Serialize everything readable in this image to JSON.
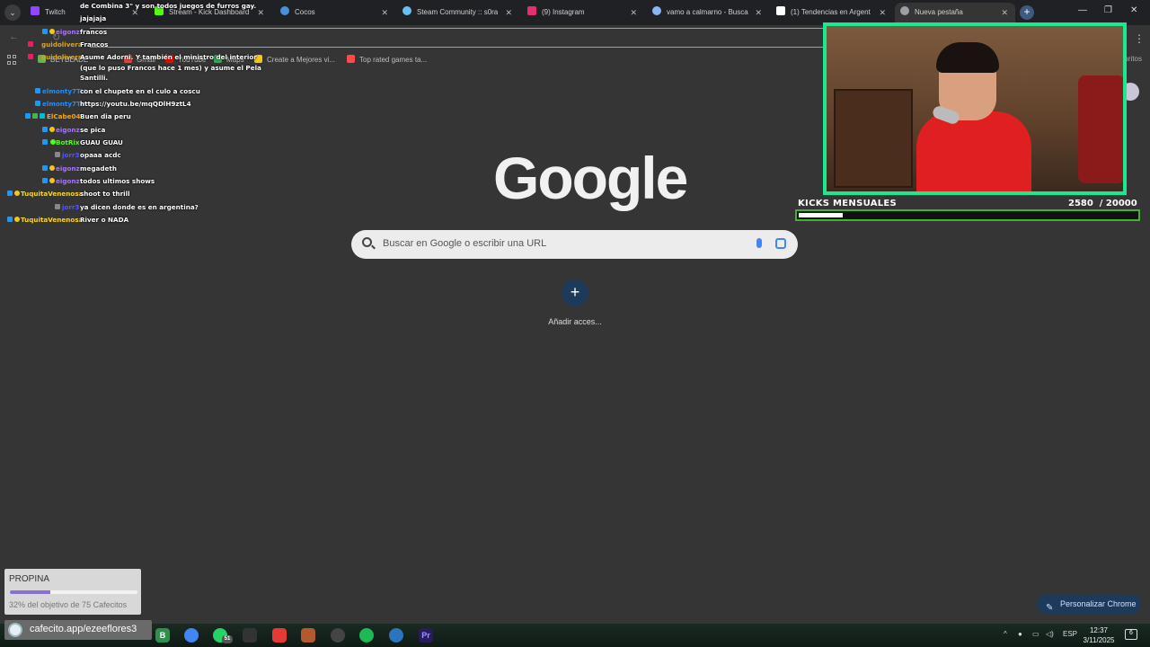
{
  "tabs": [
    {
      "title": "Twitch",
      "color": "#9146ff"
    },
    {
      "title": "Stream - Kick Dashboard",
      "color": "#53fc18"
    },
    {
      "title": "Cocos",
      "color": "#4a90d9"
    },
    {
      "title": "Steam Community :: s0ra",
      "color": "#66c0f4"
    },
    {
      "title": "(9) Instagram",
      "color": "#e1306c"
    },
    {
      "title": "vamo a calmarno - Busca",
      "color": "#8ab4f8"
    },
    {
      "title": "(1) Tendencias en Argent",
      "color": "#ffffff"
    },
    {
      "title": "Nueva pestaña",
      "color": "#9aa0a6"
    }
  ],
  "bookmarks": [
    {
      "label": "BEYBLADE",
      "color": "#6ab04c"
    },
    {
      "label": "Gmail",
      "color": "#ea4335"
    },
    {
      "label": "YouTube",
      "color": "#ff0000"
    },
    {
      "label": "Maps",
      "color": "#34a853"
    },
    {
      "label": "Create a Mejores vi...",
      "color": "#f5c518"
    },
    {
      "label": "Top rated games ta...",
      "color": "#ff4a4a"
    }
  ],
  "bookmarks_right": "Todos los favoritos",
  "google_logo": "Google",
  "search": {
    "placeholder": "Buscar en Google o escribir una URL"
  },
  "shortcut": {
    "label": "Añadir acces..."
  },
  "customize": "Personalizar Chrome",
  "chat": [
    {
      "user": "",
      "text": "de Combina 3\" y son todos juegos de furros gay.",
      "color": "#ffffff"
    },
    {
      "user": "",
      "text": "jajajaja",
      "color": "#ffffff"
    },
    {
      "user": "eigonz",
      "text": "francos",
      "color": "#a970ff"
    },
    {
      "user": "guidolivera",
      "text": "Francos",
      "color": "#daa520"
    },
    {
      "user": "guidolivera",
      "text": "Asume Adorni. Y también el ministro del interior",
      "color": "#daa520"
    },
    {
      "user": "",
      "text": "(que lo puso Francos hace 1 mes) y asume el Pela",
      "color": "#ffffff"
    },
    {
      "user": "",
      "text": "Santilli.",
      "color": "#ffffff"
    },
    {
      "user": "elmonty7TV",
      "text": "con el chupete en el culo a coscu",
      "color": "#1e90ff"
    },
    {
      "user": "elmonty7TV",
      "text": "https://youtu.be/mqQDlH9ztL4",
      "color": "#1e90ff"
    },
    {
      "user": "ElCabe04",
      "text": "Buen dia peru",
      "color": "#ffa500"
    },
    {
      "user": "eigonz",
      "text": "se pica",
      "color": "#a970ff"
    },
    {
      "user": "BotRix",
      "text": "GUAU GUAU",
      "color": "#53fc18"
    },
    {
      "user": "jorr3",
      "text": "opaaa acdc",
      "color": "#5555ff"
    },
    {
      "user": "eigonz",
      "text": "megadeth",
      "color": "#a970ff"
    },
    {
      "user": "eigonz",
      "text": "todos ultimos shows",
      "color": "#a970ff"
    },
    {
      "user": "TuquitaVenenosa",
      "text": "shoot to thrill",
      "color": "#ffd700"
    },
    {
      "user": "jorr3",
      "text": "ya dicen donde es en argentina?",
      "color": "#5555ff"
    },
    {
      "user": "TuquitaVenenosa",
      "text": "River o NADA",
      "color": "#ffd700"
    }
  ],
  "kicks": {
    "label": "KICKS MENSUALES",
    "current": 2580,
    "goal": 20000,
    "value_text": "2580  / 20000"
  },
  "tip": {
    "title": "PROPINA",
    "progress": 0.32,
    "goal_text": "32% del objetivo de 75 Cafecitos"
  },
  "cafecito": "cafecito.app/ezeeflores3",
  "taskbar_icons": [
    {
      "name": "b-app-icon",
      "label": "B",
      "color": "#2f8f4e"
    },
    {
      "name": "chrome-icon",
      "label": "",
      "color": "#4285f4"
    },
    {
      "name": "whatsapp-icon",
      "label": "",
      "color": "#25d366"
    },
    {
      "name": "shield-icon",
      "label": "",
      "color": "#333333"
    },
    {
      "name": "record-icon",
      "label": "",
      "color": "#e53935"
    },
    {
      "name": "ide-icon",
      "label": "",
      "color": "#b4592e"
    },
    {
      "name": "obs-icon",
      "label": "",
      "color": "#444444"
    },
    {
      "name": "spotify-icon",
      "label": "",
      "color": "#1db954"
    },
    {
      "name": "steam-icon",
      "label": "",
      "color": "#2a75bb"
    },
    {
      "name": "premiere-icon",
      "label": "Pr",
      "color": "#2a1a5e"
    }
  ],
  "whatsapp_badge": "51",
  "tray": {
    "lang": "ESP"
  },
  "clock": {
    "time": "12:37",
    "date": "3/11/2025"
  },
  "notifications": "6"
}
